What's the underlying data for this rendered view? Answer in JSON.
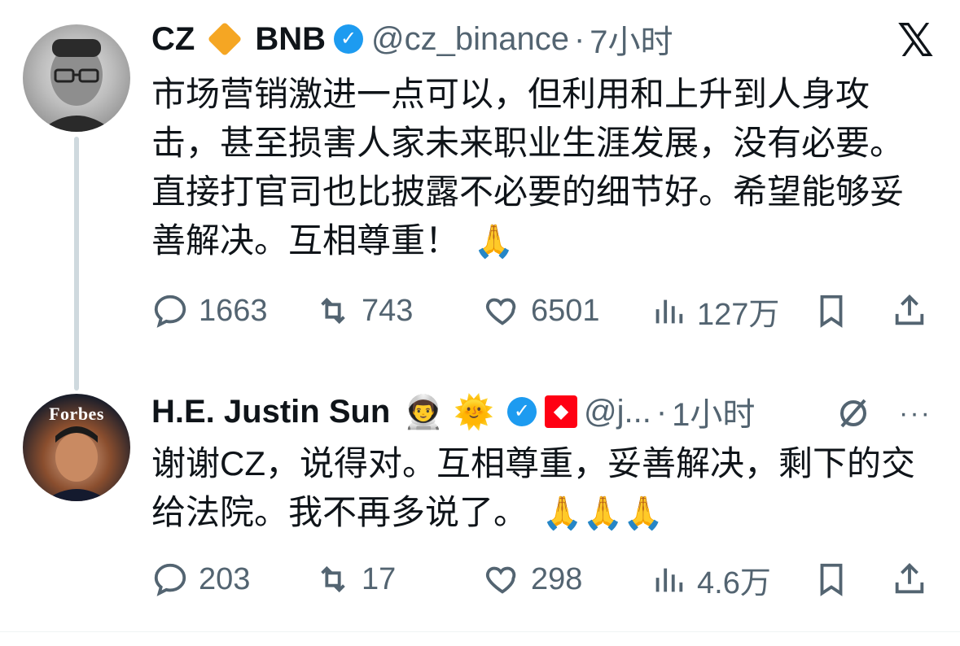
{
  "tweets": [
    {
      "name": "CZ",
      "name_suffix": "BNB",
      "handle": "@cz_binance",
      "separator": "·",
      "time": "7小时",
      "text": "市场营销激进一点可以，但利用和上升到人身攻击，甚至损害人家未来职业生涯发展，没有必要。直接打官司也比披露不必要的细节好。希望能够妥善解决。互相尊重！",
      "emoji_end": "🙏",
      "replies": "1663",
      "retweets": "743",
      "likes": "6501",
      "views": "127万",
      "avatar_icon": "cz-avatar"
    },
    {
      "name": "H.E. Justin Sun",
      "emoji_1": "👨‍🚀",
      "emoji_2": "🌞",
      "handle": "@j...",
      "separator": "·",
      "time": "1小时",
      "text": "谢谢CZ，说得对。互相尊重，妥善解决，剩下的交给法院。我不再多说了。",
      "emoji_end": "🙏🙏🙏",
      "replies": "203",
      "retweets": "17",
      "likes": "298",
      "views": "4.6万",
      "avatar_label": "Forbes"
    }
  ],
  "icons": {
    "x_logo": "𝕏",
    "reply": "reply-icon",
    "retweet": "retweet-icon",
    "like": "like-icon",
    "views": "views-icon",
    "bookmark": "bookmark-icon",
    "share": "share-icon",
    "grok": "grok-icon",
    "more": "more-icon"
  },
  "colors": {
    "text": "#0f1419",
    "muted": "#536471",
    "verified": "#1d9bf0",
    "bnb": "#f5a623",
    "tron": "#ff0013",
    "thread_line": "#cfd9de"
  }
}
